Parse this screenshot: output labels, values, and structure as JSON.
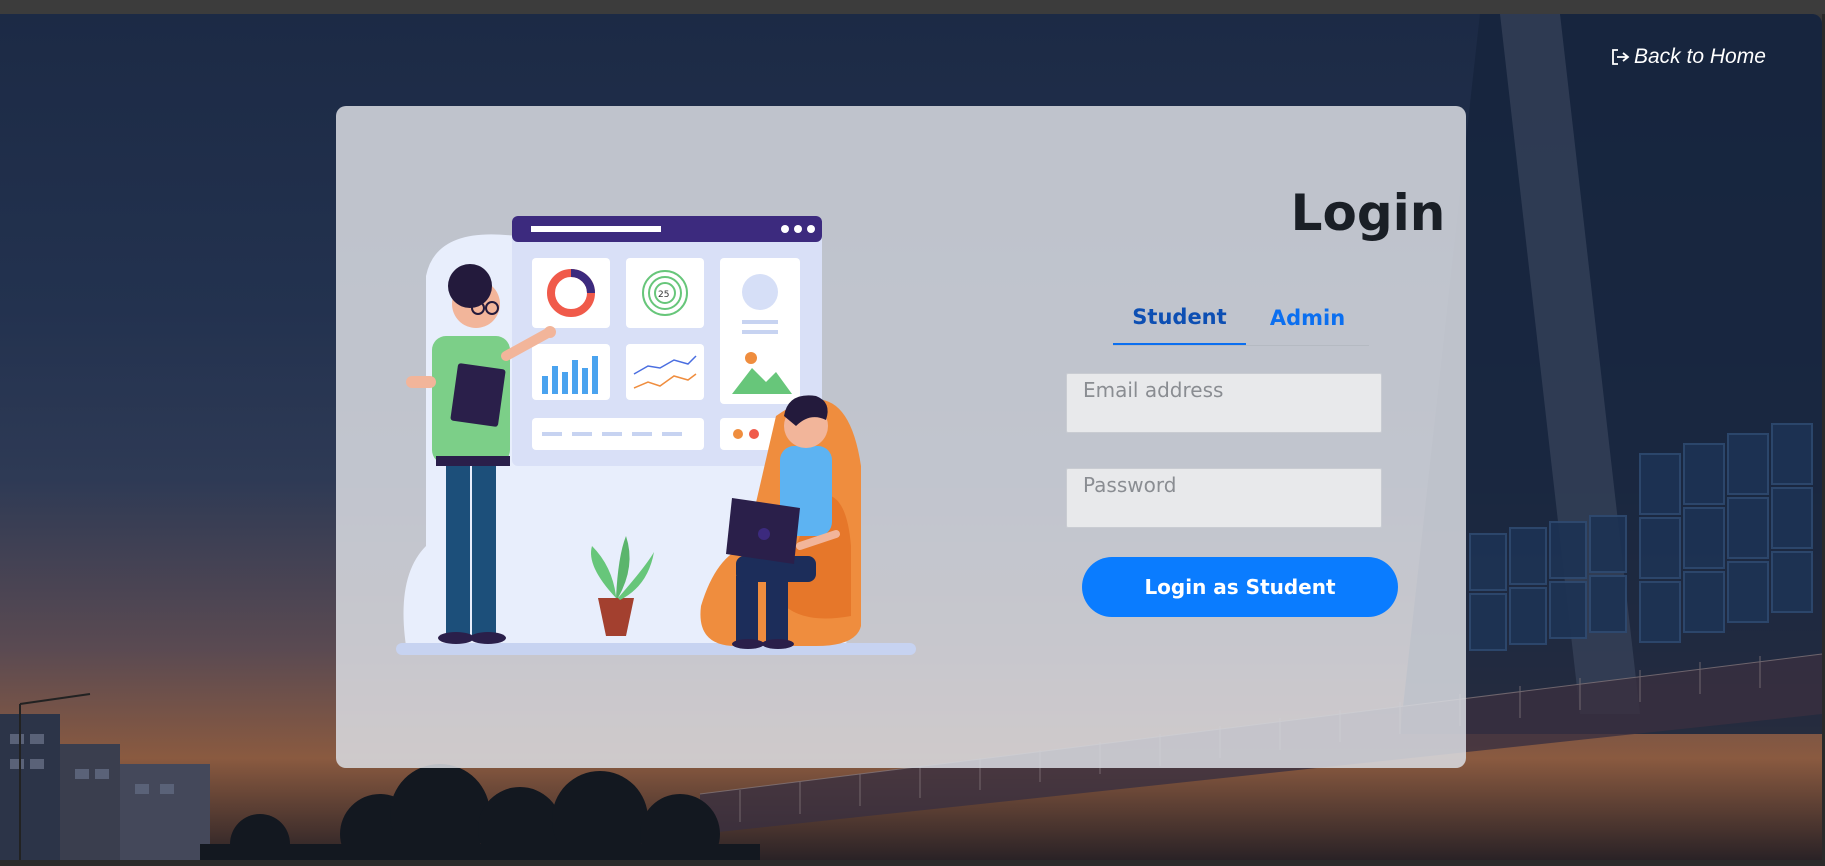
{
  "nav": {
    "back_home_label": "Back to Home",
    "back_home_icon": "exit-icon"
  },
  "login": {
    "title": "Login",
    "tabs": [
      {
        "label": "Student",
        "active": true
      },
      {
        "label": "Admin",
        "active": false
      }
    ],
    "email_placeholder": "Email address",
    "password_placeholder": "Password",
    "submit_label": "Login as Student"
  },
  "illustration": {
    "gauge_label": "25"
  },
  "colors": {
    "primary": "#0a7cff",
    "tab_active": "#0d4fb3",
    "title": "#1a1f26",
    "card_bg": "#dadce2"
  }
}
